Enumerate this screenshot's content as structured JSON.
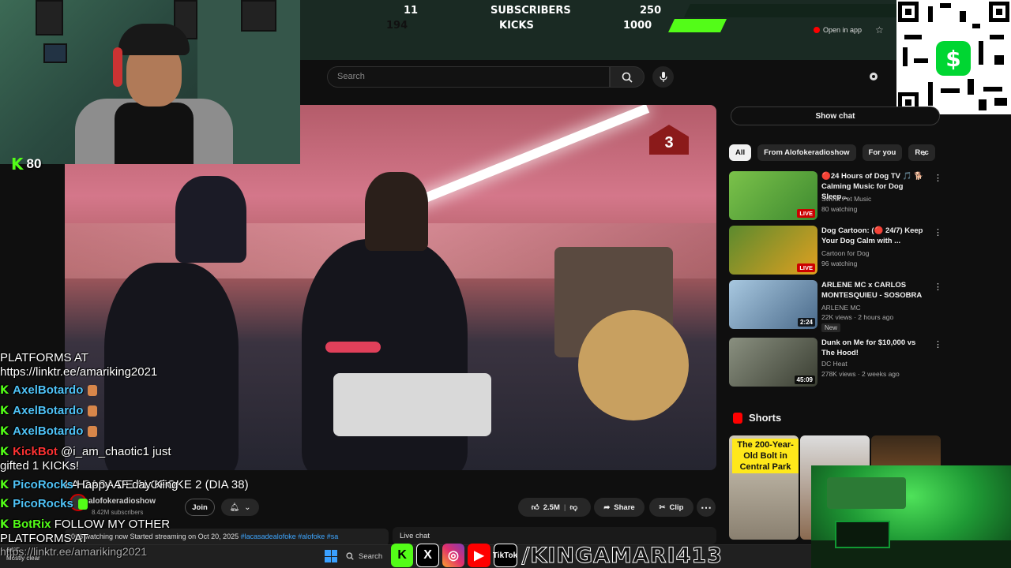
{
  "goal": {
    "row1_left": "11",
    "row1_label": "SUBSCRIBERS",
    "row1_right": "250",
    "row2_left": "194",
    "row2_label": "KICKS",
    "row2_right": "1000",
    "row2_progress": 0.194
  },
  "youtube": {
    "open_in_app": "Open in app",
    "search_placeholder": "Search",
    "show_chat": "Show chat",
    "chips": [
      "All",
      "From Alofokeradioshow",
      "For you",
      "Rec"
    ],
    "recommendations": [
      {
        "title": "🔴24 Hours of Dog TV 🎵 🐕 Calming Music for Dog Sleep...",
        "channel": "Sweet Pet Music",
        "meta": "80 watching",
        "badge": "LIVE",
        "thumb_color": "#5aa03a"
      },
      {
        "title": "Dog Cartoon: (🔴 24/7) Keep Your Dog Calm with ...",
        "channel": "Cartoon for Dog",
        "meta": "96 watching",
        "badge": "LIVE",
        "thumb_color": "#3c6a2a"
      },
      {
        "title": "ARLENE MC x CARLOS MONTESQUIEU - SOSOBRA",
        "channel": "ARLENE MC",
        "meta": "22K views · 2 hours ago",
        "badge": "2:24",
        "extra": "New",
        "thumb_color": "#7fa7c8"
      },
      {
        "title": "Dunk on Me for $10,000 vs The Hood!",
        "channel": "DC Heat",
        "meta": "278K views · 2 weeks ago",
        "badge": "45:09",
        "thumb_color": "#6a6e5e"
      }
    ],
    "shorts_label": "Shorts",
    "short_caption": "The 200-Year-Old Bolt in Central Park",
    "channel_name": "alofokeradioshow",
    "channel_subs": "8.42M subscribers",
    "join": "Join",
    "likes": "2.5M",
    "share": "Share",
    "clip": "Clip",
    "desc_prefix": "066 watching now  Started streaming on Oct 20, 2025",
    "desc_tags": "#lacasadealofoke #alofoke #sa",
    "live_chat": "Live chat",
    "video_logo": "3"
  },
  "stream": {
    "kick_count": "80",
    "qr_symbol": "$",
    "overlay_text": "LA CASA DE ALOFOKE 2 (DIA 38)"
  },
  "chat": [
    {
      "type": "text",
      "msg": "PLATFORMS AT"
    },
    {
      "type": "text",
      "msg": "https://linktr.ee/amariking2021"
    },
    {
      "type": "user",
      "user": "AxelBotardo",
      "msg": ""
    },
    {
      "type": "user",
      "user": "AxelBotardo",
      "msg": ""
    },
    {
      "type": "user",
      "user": "AxelBotardo",
      "msg": ""
    },
    {
      "type": "kickbot",
      "user": "KickBot",
      "msg": "@i_am_chaotic1 just"
    },
    {
      "type": "text",
      "msg": "gifted 1 KICKs!"
    },
    {
      "type": "user",
      "user": "PicoRocks",
      "msg": "Happy AF day King"
    },
    {
      "type": "user",
      "user": "PicoRocks",
      "msg": ""
    },
    {
      "type": "botrix",
      "user": "BotRix",
      "msg": "FOLLOW MY OTHER"
    },
    {
      "type": "text",
      "msg": "PLATFORMS AT"
    },
    {
      "type": "text",
      "msg": "https://linktr.ee/amariking2021"
    }
  ],
  "taskbar": {
    "weather_temp": "34°F",
    "weather_desc": "Mostly clear",
    "search": "Search"
  },
  "socials": {
    "handle": "/KINGAMARI413",
    "tiktok_label": "TikTok"
  },
  "colors": {
    "kick_green": "#53fc18",
    "yt_red": "#ff0000",
    "cashapp_green": "#00d632"
  }
}
